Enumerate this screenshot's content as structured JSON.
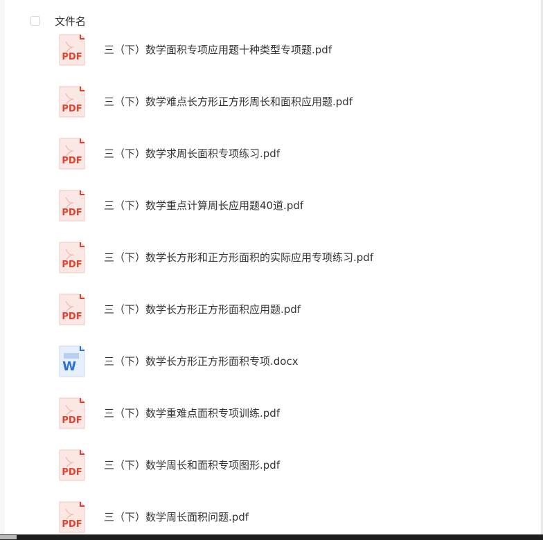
{
  "header": {
    "select_all_label": "",
    "column_filename": "文件名"
  },
  "files": [
    {
      "name": "三（下）数学面积专项应用题十种类型专项题.pdf",
      "type": "pdf",
      "icon_label": "PDF"
    },
    {
      "name": "三（下）数学难点长方形正方形周长和面积应用题.pdf",
      "type": "pdf",
      "icon_label": "PDF"
    },
    {
      "name": "三（下）数学求周长面积专项练习.pdf",
      "type": "pdf",
      "icon_label": "PDF"
    },
    {
      "name": "三（下）数学重点计算周长应用题40道.pdf",
      "type": "pdf",
      "icon_label": "PDF"
    },
    {
      "name": "三（下）数学长方形和正方形面积的实际应用专项练习.pdf",
      "type": "pdf",
      "icon_label": "PDF"
    },
    {
      "name": "三（下）数学长方形正方形面积应用题.pdf",
      "type": "pdf",
      "icon_label": "PDF"
    },
    {
      "name": "三（下）数学长方形正方形面积专项.docx",
      "type": "docx",
      "icon_label": "W"
    },
    {
      "name": "三（下）数学重难点面积专项训练.pdf",
      "type": "pdf",
      "icon_label": "PDF"
    },
    {
      "name": "三（下）数学周长和面积专项图形.pdf",
      "type": "pdf",
      "icon_label": "PDF"
    },
    {
      "name": "三（下）数学周长面积问题.pdf",
      "type": "pdf",
      "icon_label": "PDF"
    }
  ],
  "colors": {
    "pdf_accent": "#e1412f",
    "pdf_light": "#fbe7e4",
    "word_accent": "#2b6fd8",
    "word_light": "#e6effb",
    "text": "#333333"
  },
  "icons": {
    "pdf": "pdf-file-icon",
    "docx": "word-file-icon",
    "checkbox": "checkbox"
  }
}
